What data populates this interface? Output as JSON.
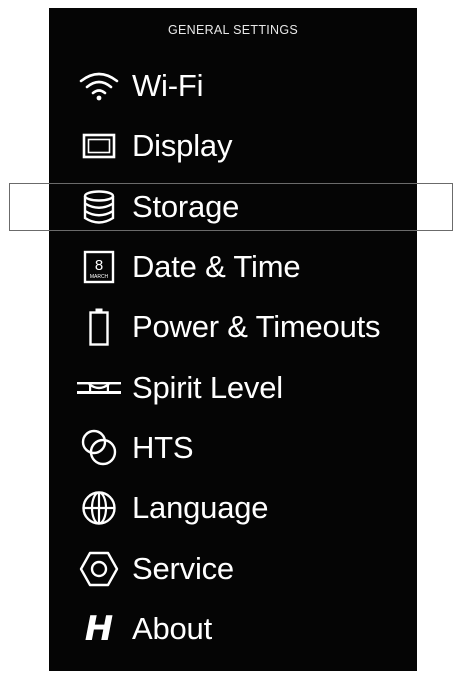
{
  "header": {
    "title": "GENERAL SETTINGS"
  },
  "menu": {
    "items": [
      {
        "label": "Wi-Fi",
        "icon": "wifi-icon"
      },
      {
        "label": "Display",
        "icon": "display-icon"
      },
      {
        "label": "Storage",
        "icon": "storage-icon",
        "selected": true
      },
      {
        "label": "Date & Time",
        "icon": "calendar-icon",
        "icon_text_day": "8",
        "icon_text_month": "MARCH"
      },
      {
        "label": "Power & Timeouts",
        "icon": "battery-icon"
      },
      {
        "label": "Spirit Level",
        "icon": "spirit-level-icon"
      },
      {
        "label": "HTS",
        "icon": "hts-icon"
      },
      {
        "label": "Language",
        "icon": "globe-icon"
      },
      {
        "label": "Service",
        "icon": "hexagon-icon"
      },
      {
        "label": "About",
        "icon": "hasselblad-logo-icon",
        "icon_text": "H"
      }
    ]
  },
  "colors": {
    "background": "#050505",
    "text": "#ffffff",
    "selection_border": "#6b6b6b"
  }
}
